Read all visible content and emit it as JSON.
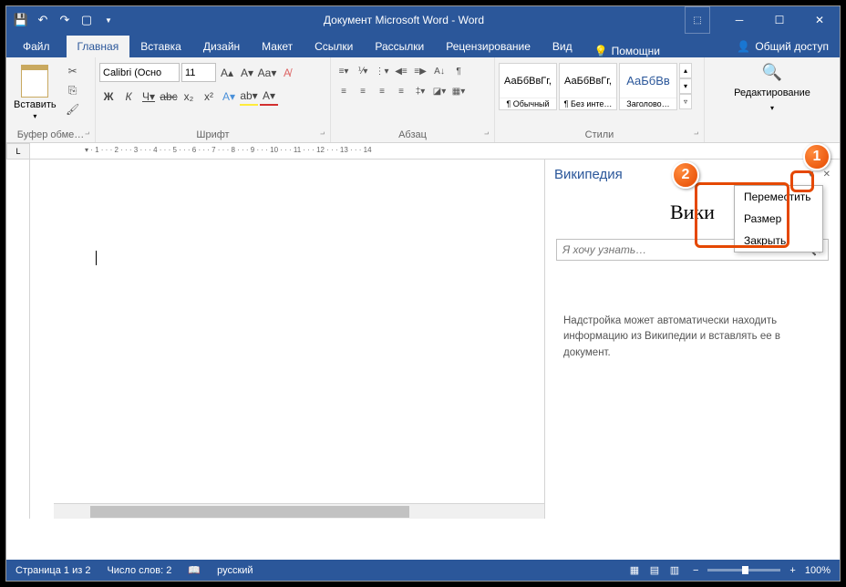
{
  "title": "Документ Microsoft Word - Word",
  "tabs": {
    "file": "Файл",
    "home": "Главная",
    "insert": "Вставка",
    "design": "Дизайн",
    "layout": "Макет",
    "references": "Ссылки",
    "mailings": "Рассылки",
    "review": "Рецензирование",
    "view": "Вид",
    "tellme": "Помощни",
    "share": "Общий доступ"
  },
  "ribbon": {
    "clipboard": {
      "paste": "Вставить",
      "group": "Буфер обме…"
    },
    "font": {
      "name": "Calibri (Осно",
      "size": "11",
      "group": "Шрифт",
      "bold": "Ж",
      "italic": "К",
      "underline": "Ч",
      "strike": "abc"
    },
    "paragraph": {
      "group": "Абзац"
    },
    "styles": {
      "group": "Стили",
      "items": [
        {
          "preview": "АаБбВвГг,",
          "name": "¶ Обычный"
        },
        {
          "preview": "АаБбВвГг,",
          "name": "¶ Без инте…"
        },
        {
          "preview": "АаБбВв",
          "name": "Заголово…"
        }
      ]
    },
    "editing": {
      "label": "Редактирование"
    }
  },
  "pane": {
    "title": "Википедия",
    "logo": "Вики",
    "search_placeholder": "Я хочу узнать…",
    "description": "Надстройка может автоматически находить информацию из Википедии и вставлять ее в документ.",
    "menu": {
      "move": "Переместить",
      "size": "Размер",
      "close": "Закрыть"
    }
  },
  "status": {
    "page": "Страница 1 из 2",
    "words": "Число слов: 2",
    "lang": "русский",
    "zoom": "100%"
  },
  "callouts": {
    "one": "1",
    "two": "2"
  },
  "ruler": "L"
}
